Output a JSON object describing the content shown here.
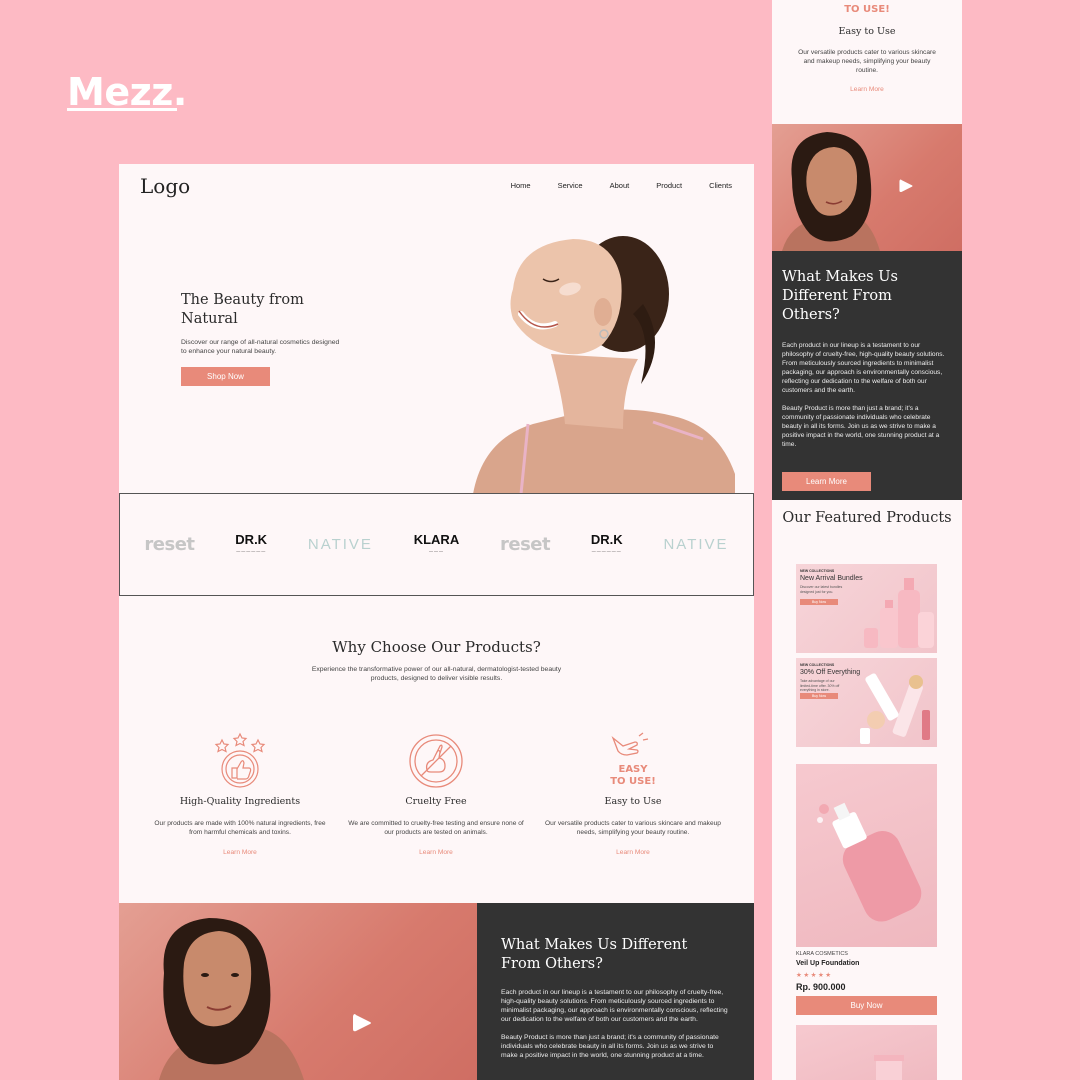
{
  "brand": {
    "name": "Mezz."
  },
  "nav": {
    "logo": "Logo",
    "items": [
      "Home",
      "Service",
      "About",
      "Product",
      "Clients"
    ]
  },
  "hero": {
    "title": "The Beauty from Natural",
    "subtitle": "Discover our range of all-natural cosmetics designed to enhance your natural beauty.",
    "button": "Shop Now"
  },
  "brands": [
    "reset",
    "DR.K",
    "NATIVE",
    "KLARA",
    "reset",
    "DR.K",
    "NATIVE"
  ],
  "why": {
    "title": "Why Choose Our Products?",
    "subtitle": "Experience the transformative power of our all-natural, dermatologist-tested beauty products, designed to deliver visible results.",
    "features": [
      {
        "title": "High-Quality Ingredients",
        "desc": "Our products are made with 100% natural ingredients, free from harmful chemicals and toxins.",
        "link": "Learn More",
        "icon": "thumbs-up-stars-icon"
      },
      {
        "title": "Cruelty Free",
        "desc": "We are committed to cruelty-free testing and ensure none of our products are tested on animals.",
        "link": "Learn More",
        "icon": "cruelty-free-rabbit-icon"
      },
      {
        "title": "Easy to Use",
        "desc": "Our versatile products cater to various skincare and makeup needs, simplifying your beauty routine.",
        "link": "Learn More",
        "icon": "easy-to-use-hand-icon",
        "icon_text": "EASY TO USE!"
      }
    ]
  },
  "different": {
    "title": "What Makes Us Different From Others?",
    "p1": "Each product in our lineup is a testament to our philosophy of cruelty-free, high-quality beauty solutions. From meticulously sourced ingredients to minimalist packaging, our approach is environmentally conscious, reflecting our dedication to the welfare of both our customers and the earth.",
    "p2": "Beauty Product is more than just a brand; it's a community of passionate individuals who celebrate beauty in all its forms. Join us as we strive to make a positive impact in the world, one stunning product at a time.",
    "button": "Learn More"
  },
  "featured": {
    "title": "Our Featured Products",
    "banners": [
      {
        "tag": "NEW COLLECTIONS",
        "title": "New Arrival Bundles",
        "desc": "Discover our latest bundles designed just for you.",
        "button": "Buy Now"
      },
      {
        "tag": "NEW COLLECTIONS",
        "title": "30% Off Everything",
        "desc": "Take advantage of our limited-time offer. 30% off everything in store.",
        "button": "Buy Now"
      }
    ],
    "product": {
      "brand": "KLARA COSMETICS",
      "name": "Veil Up Foundation",
      "stars": "★★★★★",
      "price": "Rp. 900.000",
      "button": "Buy Now"
    }
  },
  "colors": {
    "background": "#FDBAC4",
    "accent": "#E88A7A",
    "dark": "#333333",
    "page": "#FEF7F8"
  }
}
